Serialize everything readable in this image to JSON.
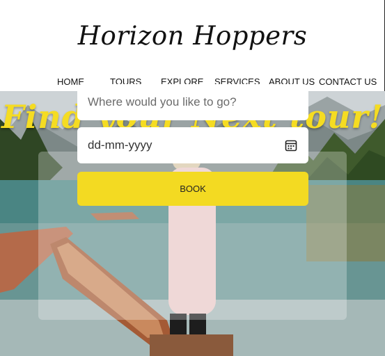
{
  "brand": {
    "name": "Horizon Hoppers"
  },
  "nav": {
    "items": [
      {
        "label": "HOME"
      },
      {
        "label": "TOURS"
      },
      {
        "label": "EXPLORE"
      },
      {
        "label": "SERVICES"
      },
      {
        "label": "ABOUT US"
      },
      {
        "label": "CONTACT US"
      }
    ]
  },
  "hero": {
    "headline": "Find your Next tour!",
    "headline_color": "#f5dc22"
  },
  "booking": {
    "destination_placeholder": "Where would you like to go?",
    "date_placeholder": "dd-mm-yyyy",
    "book_label": "BOOK",
    "accent_color": "#f3da22",
    "date_icon": "calendar-icon"
  }
}
